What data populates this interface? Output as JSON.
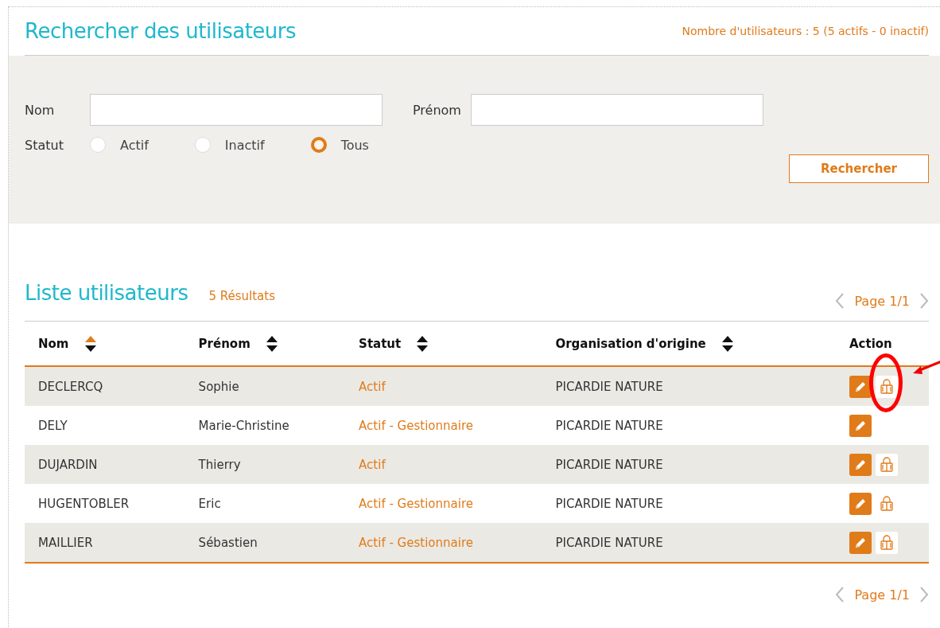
{
  "search": {
    "title": "Rechercher des utilisateurs",
    "count": "Nombre d'utilisateurs : 5 (5 actifs - 0 inactif)",
    "fields": [
      {
        "label": "Nom"
      },
      {
        "label": "Prénom"
      }
    ],
    "status": {
      "label": "Statut",
      "options": [
        {
          "label": "Actif",
          "selected": false
        },
        {
          "label": "Inactif",
          "selected": false
        },
        {
          "label": "Tous",
          "selected": true
        }
      ]
    },
    "button": "Rechercher"
  },
  "list": {
    "title": "Liste utilisateurs",
    "results": "5 Résultats",
    "page_top": "Page 1/1",
    "page_bottom": "Page 1/1",
    "columns": [
      {
        "label": "Nom",
        "sortable": true,
        "sorted": true
      },
      {
        "label": "Prénom",
        "sortable": true,
        "sorted": false
      },
      {
        "label": "Statut",
        "sortable": true,
        "sorted": false
      },
      {
        "label": "Organisation d'origine",
        "sortable": true,
        "sorted": false
      },
      {
        "label": "Action",
        "sortable": false
      }
    ],
    "rows": [
      {
        "nom": "DECLERCQ",
        "prenom": "Sophie",
        "statut": "Actif",
        "org": "PICARDIE NATURE",
        "edit": true,
        "access": true,
        "highlighted": true
      },
      {
        "nom": "DELY",
        "prenom": "Marie-Christine",
        "statut": "Actif - Gestionnaire",
        "org": "PICARDIE NATURE",
        "edit": true,
        "access": false,
        "highlighted": false
      },
      {
        "nom": "DUJARDIN",
        "prenom": "Thierry",
        "statut": "Actif",
        "org": "PICARDIE NATURE",
        "edit": true,
        "access": true,
        "highlighted": false
      },
      {
        "nom": "HUGENTOBLER",
        "prenom": "Eric",
        "statut": "Actif - Gestionnaire",
        "org": "PICARDIE NATURE",
        "edit": true,
        "access": true,
        "highlighted": false
      },
      {
        "nom": "MAILLIER",
        "prenom": "Sébastien",
        "statut": "Actif - Gestionnaire",
        "org": "PICARDIE NATURE",
        "edit": true,
        "access": true,
        "highlighted": false
      }
    ]
  }
}
